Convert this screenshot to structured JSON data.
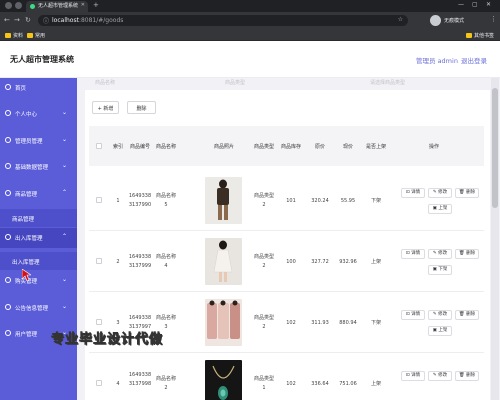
{
  "browser": {
    "tab_title": "无人超市管理系统",
    "url_host": "localhost",
    "url_path": ":8081/#/goods",
    "incognito_label": "无痕模式",
    "bookmarks": [
      "资料",
      "常用"
    ],
    "all_bookmarks": "其他书签"
  },
  "header": {
    "title": "无人超市管理系统",
    "admin_label": "管理员 admin",
    "logout_label": "退出登录"
  },
  "sidebar": {
    "items": [
      {
        "label": "首页"
      },
      {
        "label": "个人中心"
      },
      {
        "label": "管理员管理"
      },
      {
        "label": "基础数据管理"
      },
      {
        "label": "商品管理"
      },
      {
        "label": "商品管理"
      },
      {
        "label": "出入库管理"
      },
      {
        "label": "出入库管理"
      },
      {
        "label": "购买管理"
      },
      {
        "label": "公告信息管理"
      },
      {
        "label": "用户管理"
      }
    ]
  },
  "search": {
    "placeholders": [
      "商品名称",
      "商品类型",
      "请选择商品类型"
    ]
  },
  "toolbar": {
    "add_label": "+ 新增",
    "delete_label": "删除"
  },
  "table": {
    "headers": [
      "索引",
      "商品编号",
      "商品名称",
      "商品照片",
      "商品类型",
      "商品库存",
      "原价",
      "现价",
      "是否上架",
      "操作"
    ],
    "rows": [
      {
        "index": "1",
        "code1": "1649338",
        "code2": "3137990",
        "name1": "商品名称",
        "name2": "5",
        "type1": "商品类型",
        "type2": "2",
        "stock": "101",
        "price": "320.24",
        "now": "55.95",
        "status": "下架",
        "photo": "dark-jacket"
      },
      {
        "index": "2",
        "code1": "1649338",
        "code2": "3137999",
        "name1": "商品名称",
        "name2": "4",
        "type1": "商品类型",
        "type2": "2",
        "stock": "100",
        "price": "327.72",
        "now": "932.96",
        "status": "上架",
        "photo": "white-dress"
      },
      {
        "index": "3",
        "code1": "1649338",
        "code2": "3137997",
        "name1": "商品名称",
        "name2": "3",
        "type1": "商品类型",
        "type2": "2",
        "stock": "102",
        "price": "311.93",
        "now": "880.94",
        "status": "下架",
        "photo": "pink-outfits"
      },
      {
        "index": "4",
        "code1": "1649338",
        "code2": "3137998",
        "name1": "商品名称",
        "name2": "2",
        "type1": "商品类型",
        "type2": "1",
        "stock": "102",
        "price": "336.64",
        "now": "751.06",
        "status": "上架",
        "photo": "necklace"
      }
    ],
    "actions": {
      "detail": "详情",
      "edit": "修改",
      "delete": "删除",
      "shelf_on": "上架",
      "shelf_off": "下架"
    }
  },
  "watermark": "专业毕业设计代做",
  "colors": {
    "sidebar": "#5b5cd8",
    "accent": "#6a6fd8",
    "browser": "#35363a"
  }
}
